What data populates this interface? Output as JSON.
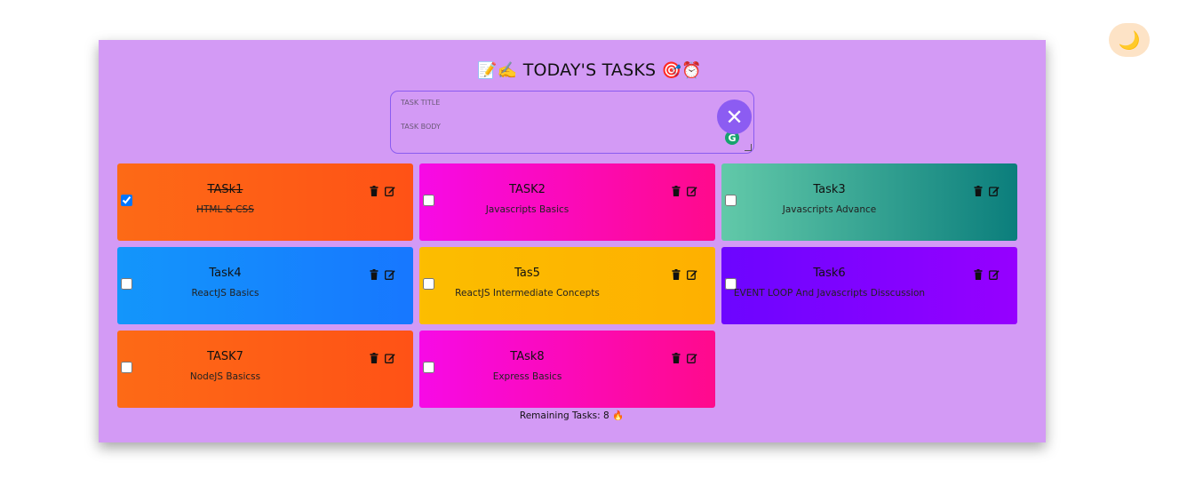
{
  "theme_toggle": {
    "icon": "moon-icon",
    "glyph": "🌙"
  },
  "header": {
    "title": "TODAY'S TASKS",
    "emoji_left": "📝✍️",
    "emoji_right": "🎯⏰"
  },
  "form": {
    "title_placeholder": "TASK TITLE",
    "body_placeholder": "TASK BODY",
    "close_glyph": "✕",
    "grammar_glyph": "G"
  },
  "tasks": [
    {
      "title": "TASk1",
      "body": "HTML & CSS",
      "checked": true,
      "gradient": [
        "#fd6a16",
        "#ff5216"
      ]
    },
    {
      "title": "TASK2",
      "body": "Javascripts Basics",
      "checked": false,
      "gradient": [
        "#f70ae6",
        "#ff0a8c"
      ]
    },
    {
      "title": "Task3",
      "body": "Javascripts Advance",
      "checked": false,
      "gradient": [
        "#62c9a9",
        "#0b7e7c"
      ]
    },
    {
      "title": "Task4",
      "body": "ReactJS Basics",
      "checked": false,
      "gradient": [
        "#1396fb",
        "#1777ff"
      ]
    },
    {
      "title": "Tas5",
      "body": "ReactJS Intermediate Concepts",
      "checked": false,
      "gradient": [
        "#fcbd00",
        "#feb000"
      ]
    },
    {
      "title": "Task6",
      "body": "EVENT LOOP And Javascripts Disscussion",
      "checked": false,
      "gradient": [
        "#6c05ff",
        "#9600ff"
      ]
    },
    {
      "title": "TASK7",
      "body": "NodeJS Basicss",
      "checked": false,
      "gradient": [
        "#fd6a16",
        "#ff5216"
      ]
    },
    {
      "title": "TAsk8",
      "body": "Express Basics",
      "checked": false,
      "gradient": [
        "#f70ae6",
        "#ff0a8c"
      ]
    }
  ],
  "footer": {
    "remaining": "Remaining Tasks: 8 🔥"
  },
  "colors": {
    "panel": "#d39af5",
    "accent": "#8c5cf2"
  }
}
